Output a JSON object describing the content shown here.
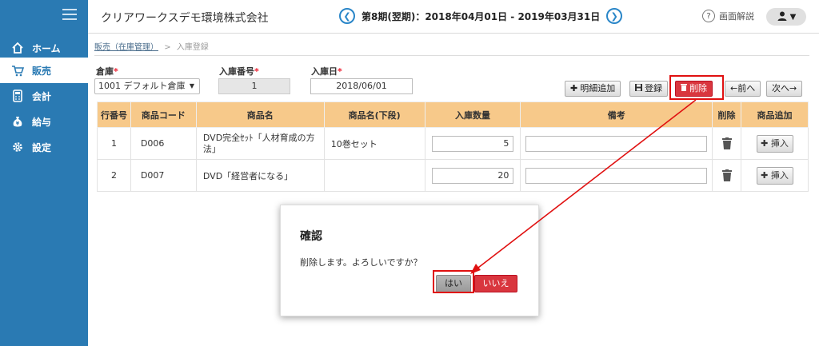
{
  "sidebar": {
    "items": [
      {
        "label": "ホーム",
        "icon": "home-icon"
      },
      {
        "label": "販売",
        "icon": "cart-icon"
      },
      {
        "label": "会計",
        "icon": "calculator-icon"
      },
      {
        "label": "給与",
        "icon": "money-bag-icon"
      },
      {
        "label": "設定",
        "icon": "gear-icon"
      }
    ],
    "active": "販売"
  },
  "header": {
    "company": "クリアワークスデモ環境株式会社",
    "period": "第8期(翌期)：2018年04月01日 - 2019年03月31日",
    "help_label": "画面解説"
  },
  "breadcrumb": {
    "parent": "販売（在庫管理）",
    "separator": ">",
    "current": "入庫登録"
  },
  "form": {
    "warehouse_label": "倉庫",
    "warehouse_value": "1001 デフォルト倉庫",
    "receipt_no_label": "入庫番号",
    "receipt_no_value": "1",
    "receipt_date_label": "入庫日",
    "receipt_date_value": "2018/06/01",
    "required_mark": "*"
  },
  "toolbar": {
    "add_line": "明細追加",
    "register": "登録",
    "delete": "削除",
    "prev": "←前へ",
    "next": "次へ→"
  },
  "table": {
    "headers": [
      "行番号",
      "商品コード",
      "商品名",
      "商品名(下段)",
      "入庫数量",
      "備考",
      "削除",
      "商品追加"
    ],
    "insert_label": "挿入",
    "rows": [
      {
        "line": "1",
        "code": "D006",
        "name": "DVD完全ｾｯﾄ「人材育成の方法」",
        "sub_name": "10巻セット",
        "qty": "5",
        "memo": ""
      },
      {
        "line": "2",
        "code": "D007",
        "name": "DVD「経営者になる」",
        "sub_name": "",
        "qty": "20",
        "memo": ""
      }
    ]
  },
  "dialog": {
    "title": "確認",
    "message": "削除します。よろしいですか？",
    "yes": "はい",
    "no": "いいえ"
  },
  "colors": {
    "sidebar": "#2a7ab3",
    "table_header": "#f7c98a",
    "danger": "#d9363e",
    "annotation": "#e01010"
  }
}
